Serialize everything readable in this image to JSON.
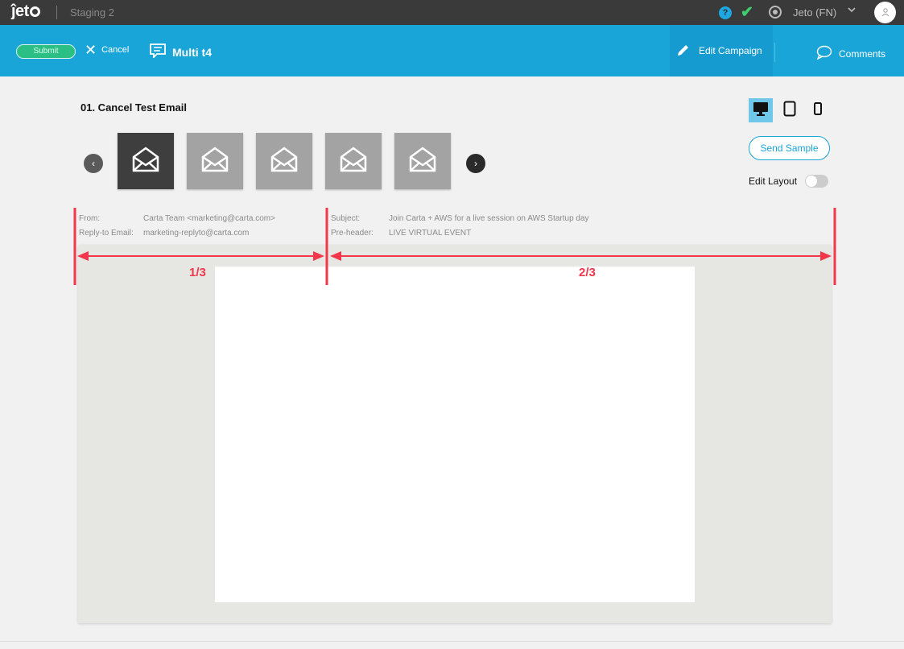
{
  "topbar": {
    "logo": "jeto",
    "environment": "Staging 2",
    "user": "Jeto (FN)",
    "help_glyph": "?",
    "check_glyph": "✔",
    "chevron_glyph": "⌄"
  },
  "actionbar": {
    "submit_label": "Submit",
    "cancel_label": "Cancel",
    "campaign_name": "Multi t4",
    "edit_campaign_label": "Edit Campaign",
    "comments_label": "Comments"
  },
  "email": {
    "title": "01. Cancel Test Email",
    "thumbnails_count_shown": 5,
    "active_thumbnail": 1
  },
  "devices": {
    "selected": "desktop",
    "options": [
      "desktop-icon",
      "tablet-icon",
      "mobile-icon"
    ]
  },
  "controls": {
    "send_sample_label": "Send Sample",
    "edit_layout_label": "Edit Layout",
    "edit_layout_on": false
  },
  "headers": {
    "from_label": "From:",
    "from_value": "Carta Team <marketing@carta.com>",
    "reply_label": "Reply-to Email:",
    "reply_value": "marketing-replyto@carta.com",
    "subject_label": "Subject:",
    "subject_value": "Join Carta + AWS for a live session on AWS Startup day",
    "preheader_label": "Pre-header:",
    "preheader_value": "LIVE VIRTUAL EVENT"
  },
  "annotation": {
    "left_label": "1/3",
    "right_label": "2/3",
    "color": "#f2374b"
  },
  "colors": {
    "topbar": "#3a3a3a",
    "actionbar": "#19a5d8",
    "submit": "#2bbf84"
  }
}
